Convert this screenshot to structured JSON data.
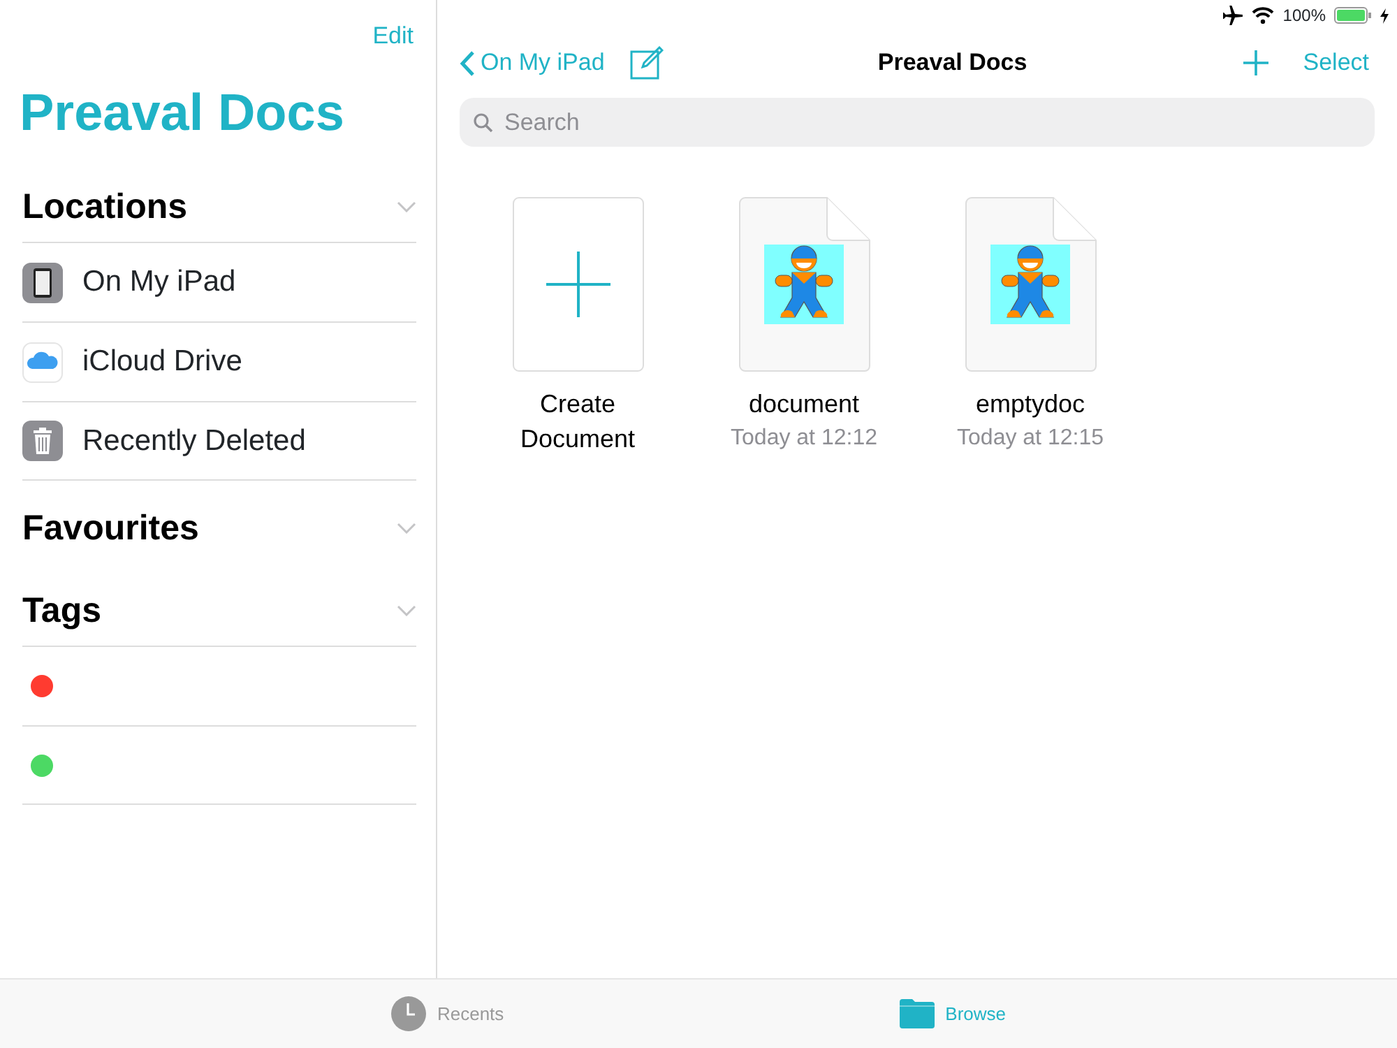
{
  "status_bar": {
    "battery": "100%",
    "charging": true
  },
  "sidebar": {
    "edit": "Edit",
    "title": "Preaval Docs",
    "sections": [
      {
        "title": "Locations",
        "items": [
          {
            "kind": "ipad",
            "label": "On My iPad"
          },
          {
            "kind": "icloud",
            "label": "iCloud Drive"
          },
          {
            "kind": "trash",
            "label": "Recently Deleted"
          }
        ]
      },
      {
        "title": "Favourites"
      },
      {
        "title": "Tags",
        "items": [
          {
            "kind": "tag",
            "color": "#ff3b30"
          },
          {
            "kind": "tag",
            "color": "#4cd964"
          }
        ]
      }
    ]
  },
  "header": {
    "back": "On My iPad",
    "title": "Preaval Docs",
    "select": "Select"
  },
  "search": {
    "placeholder": "Search"
  },
  "items": [
    {
      "kind": "create",
      "name": "Create Document"
    },
    {
      "kind": "file",
      "name": "document",
      "date": "Today at 12:12"
    },
    {
      "kind": "file",
      "name": "emptydoc",
      "date": "Today at 12:15"
    }
  ],
  "tabs": [
    {
      "kind": "recents",
      "label": "Recents",
      "selected": false
    },
    {
      "kind": "browse",
      "label": "Browse",
      "selected": true
    }
  ]
}
